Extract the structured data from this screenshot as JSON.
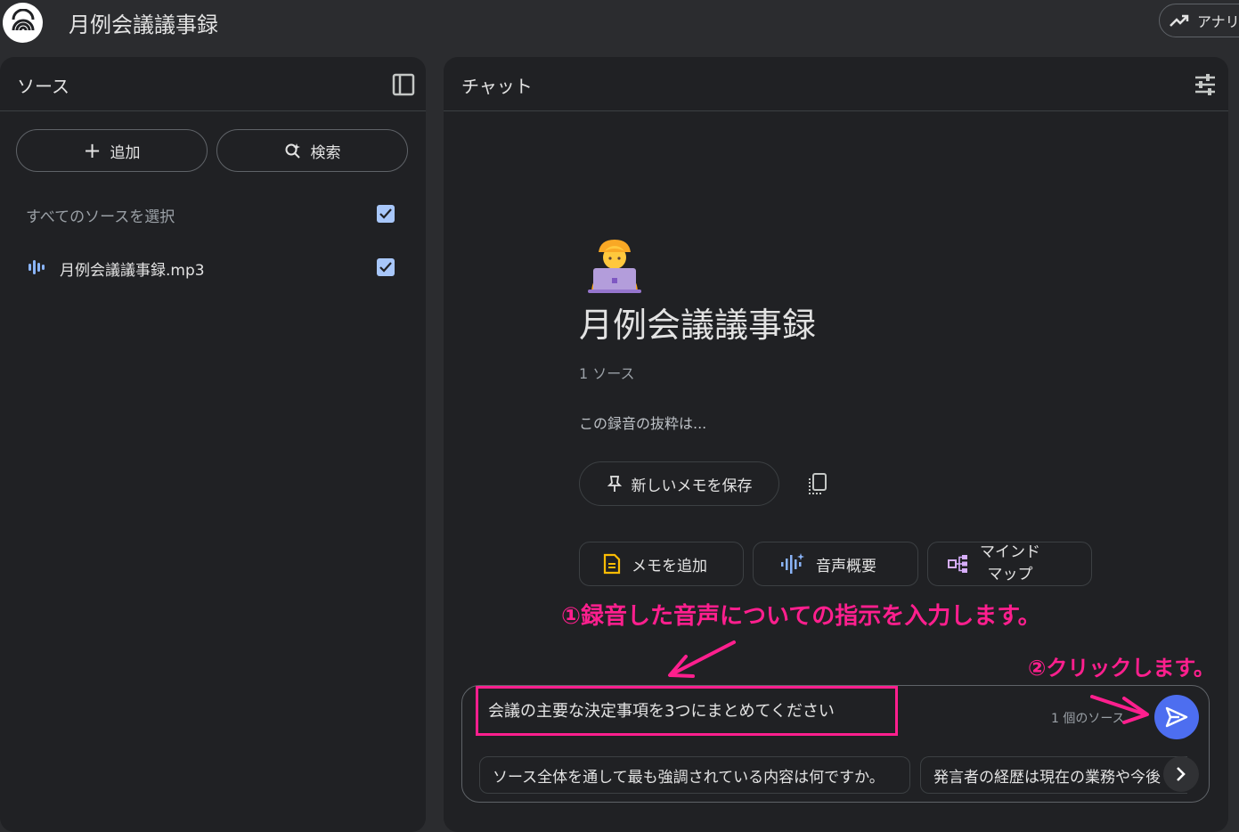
{
  "header": {
    "title": "月例会議議事録",
    "analytics_label": "アナリ"
  },
  "sources_panel": {
    "title": "ソース",
    "add_label": "追加",
    "search_label": "検索",
    "select_all_label": "すべてのソースを選択",
    "items": [
      {
        "name": "月例会議議事録.mp3",
        "icon": "audio-icon",
        "checked": true
      }
    ]
  },
  "chat_panel": {
    "title": "チャット",
    "notebook_title": "月例会議議事録",
    "source_count": "1 ソース",
    "summary": "この録音の抜粋は...",
    "save_note_label": "新しいメモを保存",
    "actions": [
      {
        "label": "メモを追加",
        "icon": "note-icon"
      },
      {
        "label": "音声概要",
        "icon": "audio-overview-icon"
      },
      {
        "label": "マインド\nマップ",
        "icon": "mind-map-icon"
      }
    ],
    "input_value": "会議の主要な決定事項を3つにまとめてください",
    "input_source_count": "1 個のソース",
    "suggestions": [
      "ソース全体を通して最も強調されている内容は何ですか。",
      "発言者の経歴は現在の業務や今後"
    ]
  },
  "annotations": {
    "step1": "①録音した音声についての指示を入力します。",
    "step2": "②クリックします。"
  },
  "colors": {
    "accent": "#4d6ef0",
    "annotation": "#ff1f8e",
    "panel": "#202124",
    "background": "#2b2c2f"
  }
}
